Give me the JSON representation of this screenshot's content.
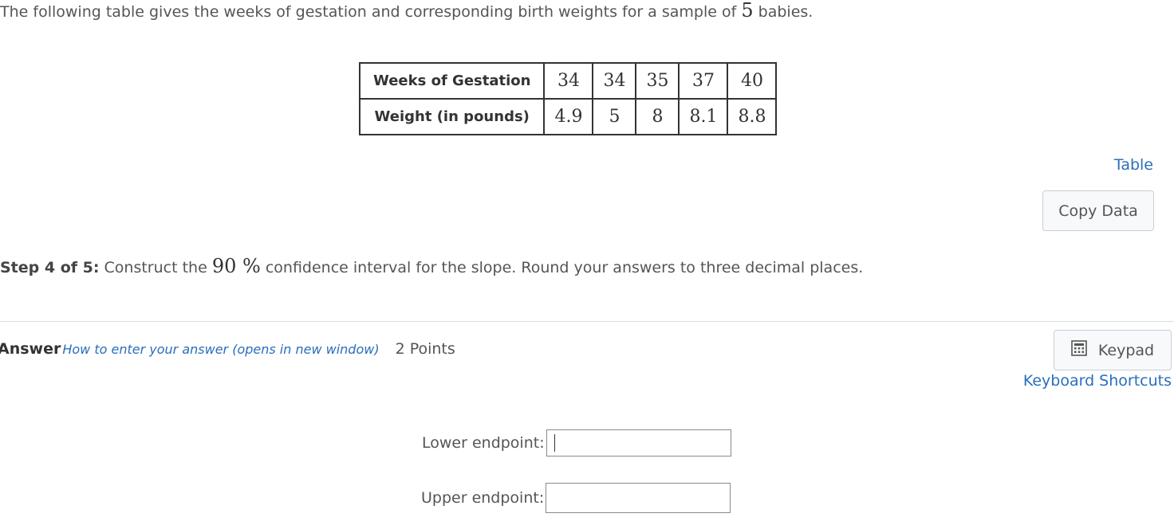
{
  "problem": {
    "intro_before": "The following table gives the weeks of gestation and corresponding birth weights for a sample of ",
    "sample_size": "5",
    "intro_after": " babies."
  },
  "table": {
    "row1_header": "Weeks of Gestation",
    "row1_values": [
      "34",
      "34",
      "35",
      "37",
      "40"
    ],
    "row2_header": "Weight (in pounds)",
    "row2_values": [
      "4.9",
      "5",
      "8",
      "8.1",
      "8.8"
    ]
  },
  "links": {
    "table": "Table",
    "keyboard_shortcuts": "Keyboard Shortcuts"
  },
  "buttons": {
    "copy_data": "Copy Data",
    "keypad": "Keypad"
  },
  "step": {
    "label": "Step 4 of 5:",
    "text_before": " Construct the ",
    "confidence": "90 %",
    "text_after": "  confidence interval for the slope. Round your answers to three decimal places."
  },
  "answer": {
    "label": "Answer",
    "howto": "How to enter your answer (opens in new window)",
    "points": "2 Points"
  },
  "fields": {
    "lower_label": "Lower endpoint:",
    "lower_value": "",
    "upper_label": "Upper endpoint:",
    "upper_value": ""
  },
  "colors": {
    "link": "#2a6ebb",
    "text": "#555555",
    "border": "#333333"
  },
  "icons": {
    "keypad": "calculator-icon"
  }
}
